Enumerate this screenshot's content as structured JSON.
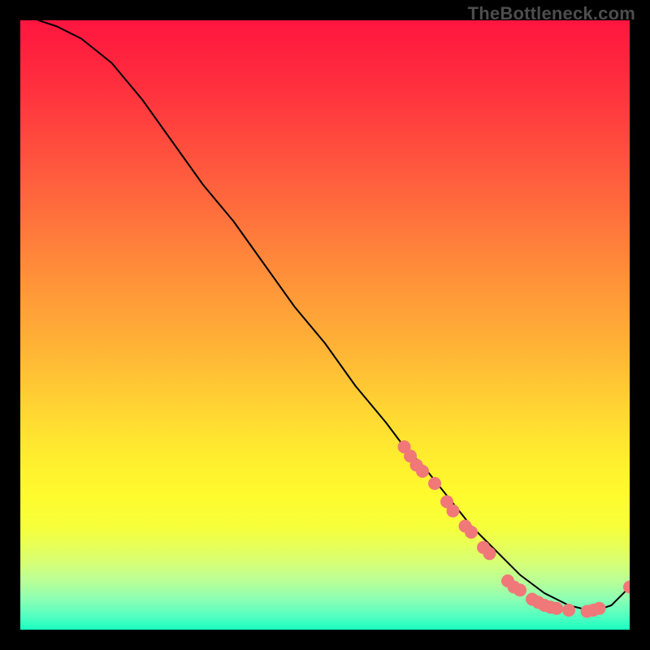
{
  "attribution": "TheBottleneck.com",
  "chart_data": {
    "type": "line",
    "title": "",
    "xlabel": "",
    "ylabel": "",
    "xlim": [
      0,
      100
    ],
    "ylim": [
      0,
      100
    ],
    "series": [
      {
        "name": "curve",
        "color": "#000000",
        "x": [
          3,
          6,
          10,
          15,
          20,
          25,
          30,
          35,
          40,
          45,
          50,
          55,
          60,
          63,
          66,
          70,
          74,
          78,
          82,
          86,
          90,
          94,
          97,
          100
        ],
        "y": [
          100,
          99,
          97,
          93,
          87,
          80,
          73,
          67,
          60,
          53,
          47,
          40,
          34,
          30,
          27,
          22,
          17,
          13,
          9,
          6,
          4,
          3,
          4,
          7
        ]
      }
    ],
    "markers": {
      "name": "highlighted-points",
      "color": "#f07878",
      "radius_px": 8,
      "points": [
        {
          "x": 63,
          "y": 30
        },
        {
          "x": 64,
          "y": 28.5
        },
        {
          "x": 65,
          "y": 27
        },
        {
          "x": 66,
          "y": 26
        },
        {
          "x": 68,
          "y": 24
        },
        {
          "x": 70,
          "y": 21
        },
        {
          "x": 71,
          "y": 19.5
        },
        {
          "x": 73,
          "y": 17
        },
        {
          "x": 74,
          "y": 16
        },
        {
          "x": 76,
          "y": 13.5
        },
        {
          "x": 77,
          "y": 12.5
        },
        {
          "x": 80,
          "y": 8
        },
        {
          "x": 81,
          "y": 7
        },
        {
          "x": 82,
          "y": 6.5
        },
        {
          "x": 84,
          "y": 5
        },
        {
          "x": 85,
          "y": 4.5
        },
        {
          "x": 86,
          "y": 4
        },
        {
          "x": 87,
          "y": 3.7
        },
        {
          "x": 88,
          "y": 3.5
        },
        {
          "x": 90,
          "y": 3.2
        },
        {
          "x": 93,
          "y": 3
        },
        {
          "x": 94,
          "y": 3.2
        },
        {
          "x": 95,
          "y": 3.5
        },
        {
          "x": 100,
          "y": 7
        }
      ]
    },
    "background_gradient": {
      "direction": "top-to-bottom",
      "stops": [
        {
          "pos": 0.0,
          "color": "#ff153f"
        },
        {
          "pos": 0.4,
          "color": "#ff8a3a"
        },
        {
          "pos": 0.72,
          "color": "#ffee2e"
        },
        {
          "pos": 1.0,
          "color": "#18ffbf"
        }
      ]
    }
  }
}
